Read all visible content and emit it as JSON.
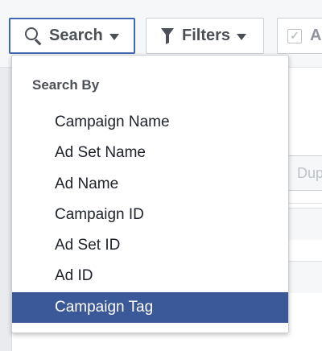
{
  "toolbar": {
    "search_label": "Search",
    "filters_label": "Filters",
    "partial_label": "A",
    "partial_checked": true
  },
  "background": {
    "duplicate_label": "Dup"
  },
  "dropdown": {
    "header": "Search By",
    "items": [
      {
        "label": "Campaign Name"
      },
      {
        "label": "Ad Set Name"
      },
      {
        "label": "Ad Name"
      },
      {
        "label": "Campaign ID"
      },
      {
        "label": "Ad Set ID"
      },
      {
        "label": "Ad ID"
      },
      {
        "label": "Campaign Tag"
      }
    ],
    "selected_index": 6
  },
  "colors": {
    "accent": "#4267b2",
    "selected_bg": "#3b5998",
    "selected_text": "#ffffff",
    "text": "#1d2129",
    "muted": "#4b4f56"
  },
  "icons": {
    "search": "search-icon",
    "filters": "funnel-icon",
    "caret": "caret-down-icon",
    "checkbox": "checkmark-icon"
  }
}
